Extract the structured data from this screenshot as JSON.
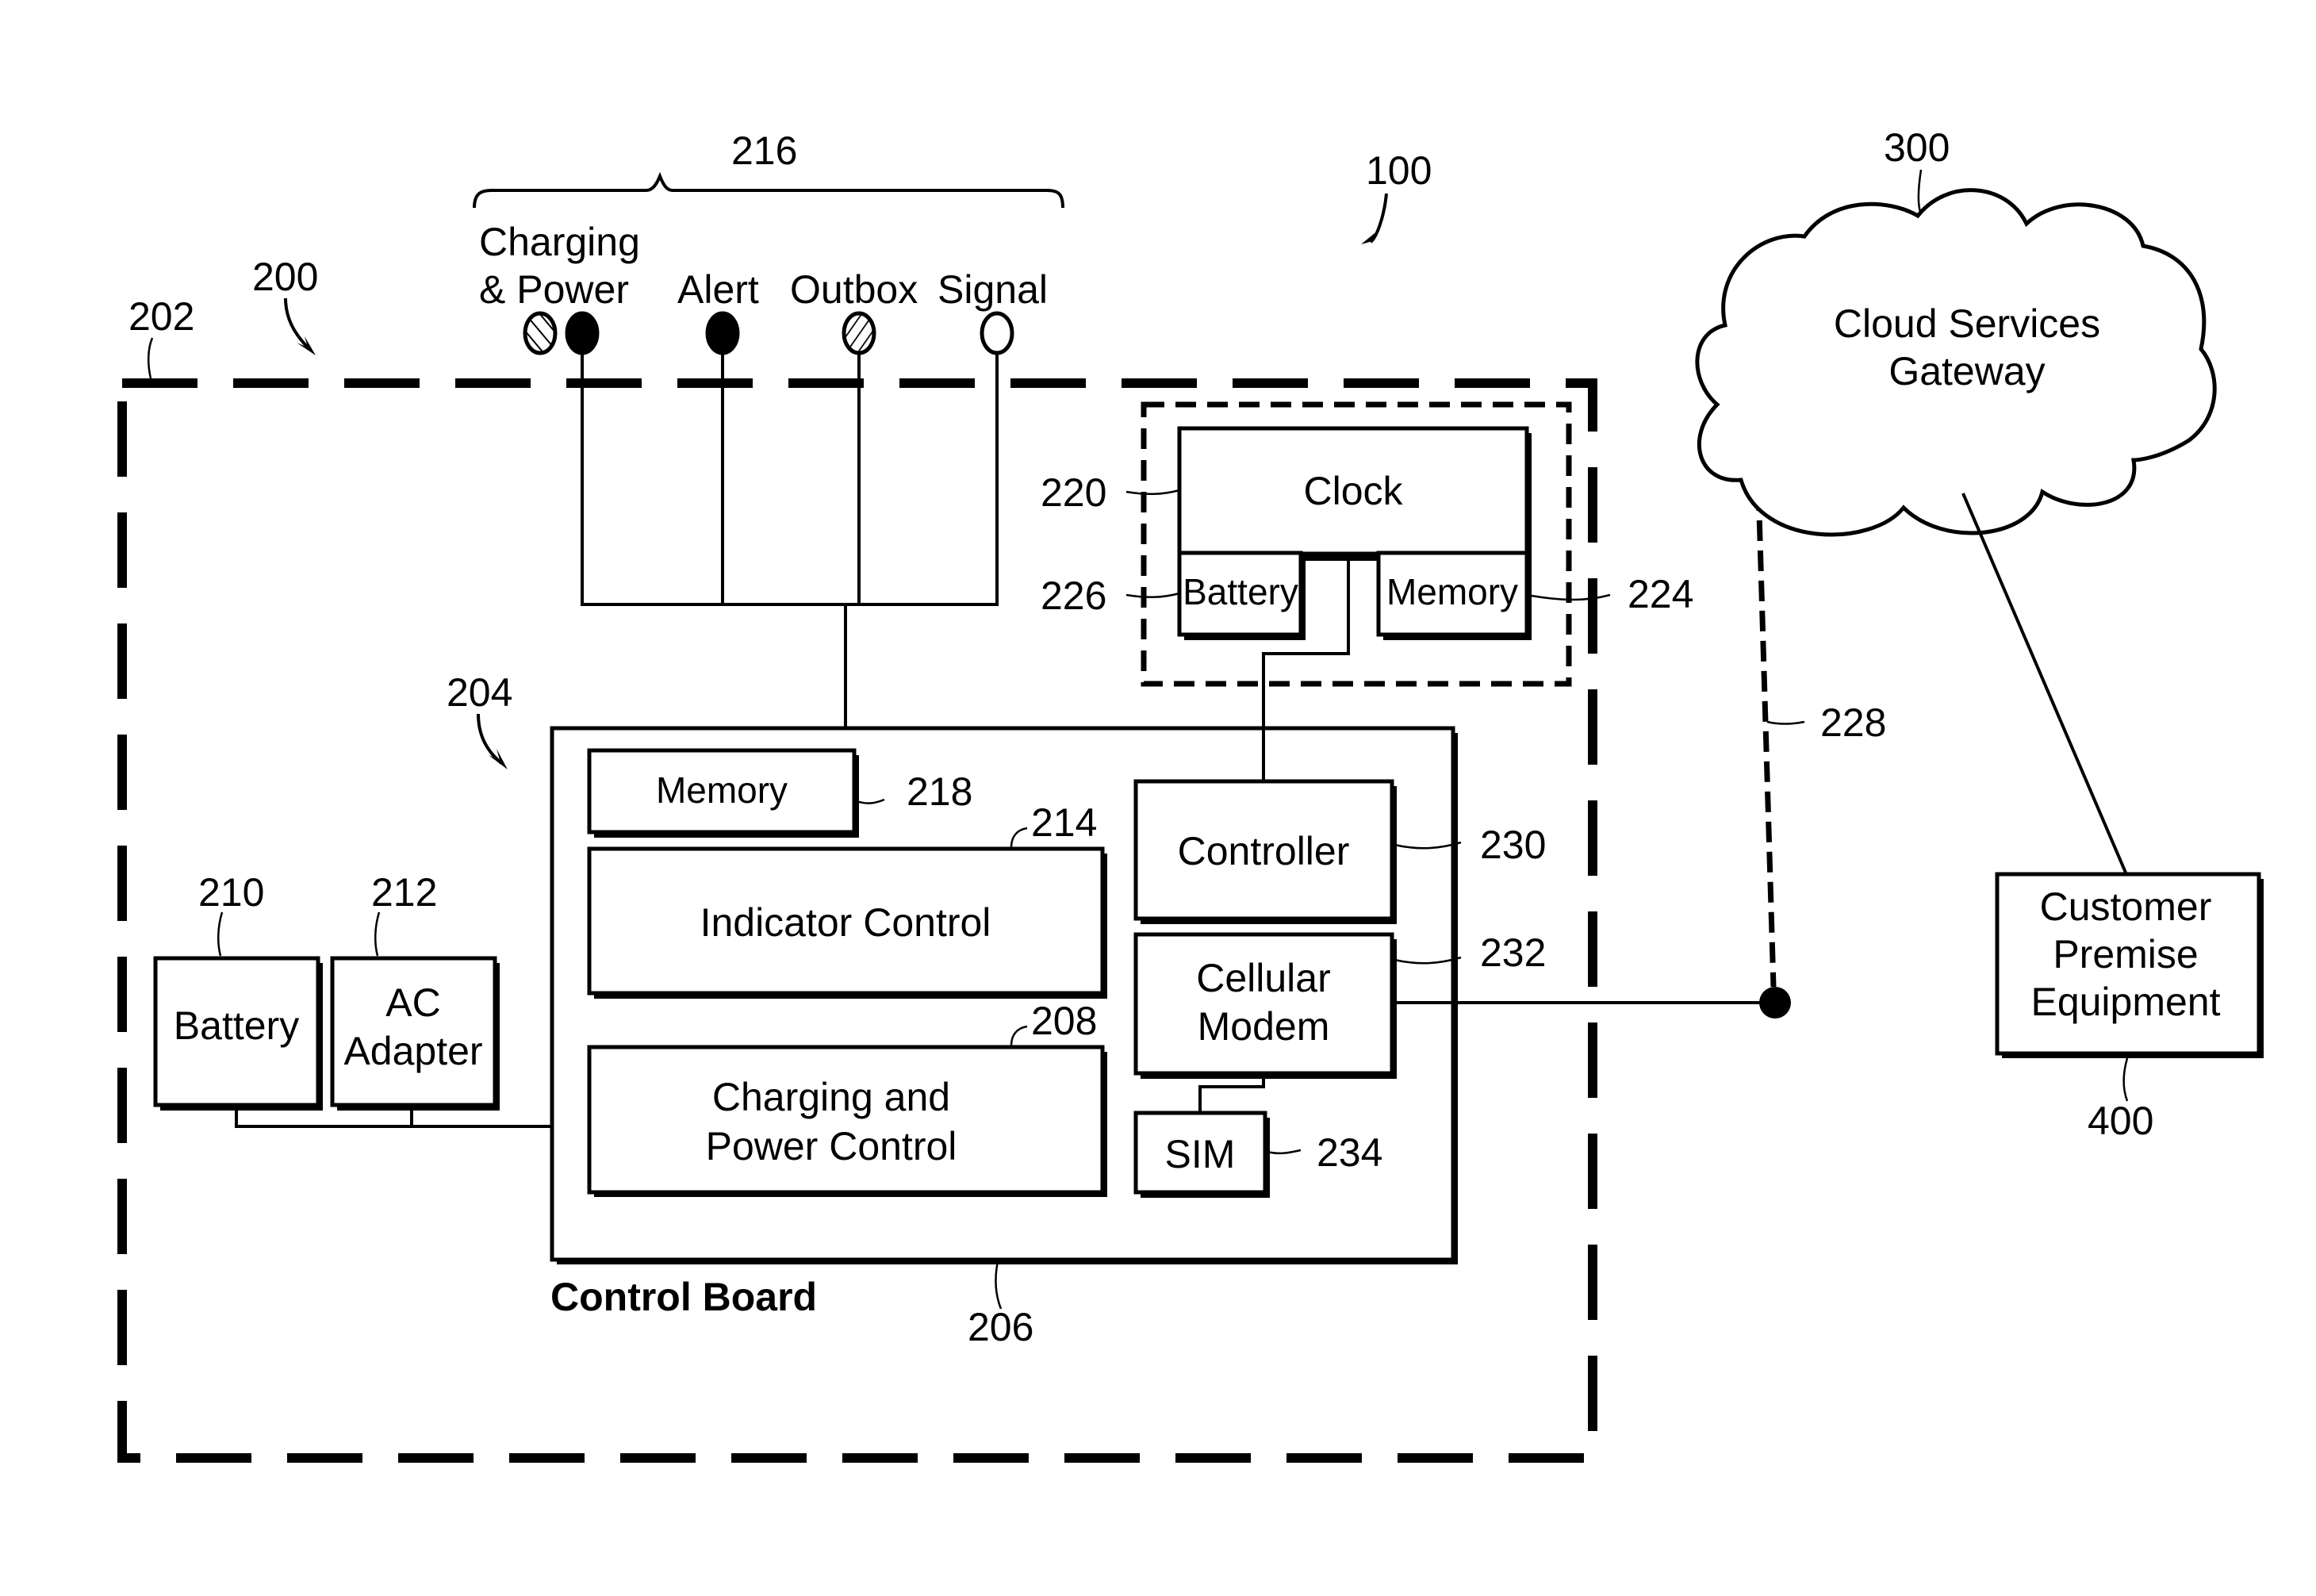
{
  "figure": {
    "system_ref": "100",
    "device": {
      "ref": "200",
      "housing_ref": "202",
      "board_assembly_ref": "204",
      "indicators": {
        "group_ref": "216",
        "items": [
          {
            "label_line1": "Charging",
            "label_line2": "& Power",
            "style": "hatched + filled"
          },
          {
            "label": "Alert",
            "style": "filled"
          },
          {
            "label": "Outbox",
            "style": "hatched"
          },
          {
            "label": "Signal",
            "style": "hollow"
          }
        ]
      },
      "battery": {
        "label": "Battery",
        "ref": "210"
      },
      "ac_adapter": {
        "label_line1": "AC",
        "label_line2": "Adapter",
        "ref": "212"
      },
      "control_board": {
        "caption": "Control Board",
        "ref": "206",
        "memory": {
          "label": "Memory",
          "ref": "218"
        },
        "indicator_control": {
          "label": "Indicator Control",
          "ref": "214"
        },
        "charging_power_control": {
          "label_line1": "Charging and",
          "label_line2": "Power Control",
          "ref": "208"
        },
        "controller": {
          "label": "Controller",
          "ref": "230"
        },
        "cellular_modem": {
          "label_line1": "Cellular",
          "label_line2": "Modem",
          "ref": "232"
        },
        "sim": {
          "label": "SIM",
          "ref": "234"
        }
      },
      "clock_module": {
        "clock": {
          "label": "Clock",
          "ref": "220"
        },
        "battery": {
          "label": "Battery",
          "ref": "226"
        },
        "memory": {
          "label": "Memory",
          "ref": "224"
        }
      }
    },
    "wireless_link_ref": "228",
    "cloud": {
      "label_line1": "Cloud Services",
      "label_line2": "Gateway",
      "ref": "300"
    },
    "cpe": {
      "label_line1": "Customer",
      "label_line2": "Premise",
      "label_line3": "Equipment",
      "ref": "400"
    }
  }
}
